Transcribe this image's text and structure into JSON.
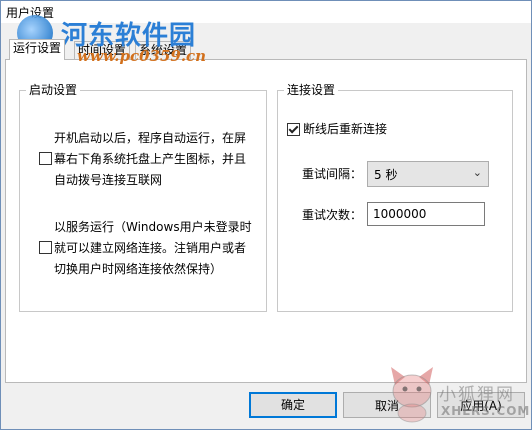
{
  "window": {
    "title": "用户设置"
  },
  "watermark": {
    "site_name": "河东软件园",
    "site_url": "www.pc0359.cn",
    "corner_brand": "小狐狸网",
    "corner_url": "XHLRS.COM"
  },
  "tabs": [
    {
      "label": "运行设置",
      "active": true
    },
    {
      "label": "时间设置",
      "active": false
    },
    {
      "label": "系统设置",
      "active": false
    }
  ],
  "startup_group": {
    "title": "启动设置",
    "options": [
      {
        "lines": [
          "开机启动以后，程序自动运行，在屏",
          "幕右下角系统托盘上产生图标，并且",
          "自动拨号连接互联网"
        ],
        "checked": false
      },
      {
        "lines": [
          "以服务运行（Windows用户未登录时",
          "就可以建立网络连接。注销用户或者",
          "切换用户时网络连接依然保持）"
        ],
        "checked": false
      }
    ]
  },
  "connection_group": {
    "title": "连接设置",
    "reconnect_label": "断线后重新连接",
    "reconnect_checked": true,
    "interval_label": "重试间隔：",
    "interval_value": "5 秒",
    "retries_label": "重试次数：",
    "retries_value": "1000000"
  },
  "buttons": {
    "ok": "确定",
    "cancel": "取消",
    "apply": "应用(A)"
  }
}
